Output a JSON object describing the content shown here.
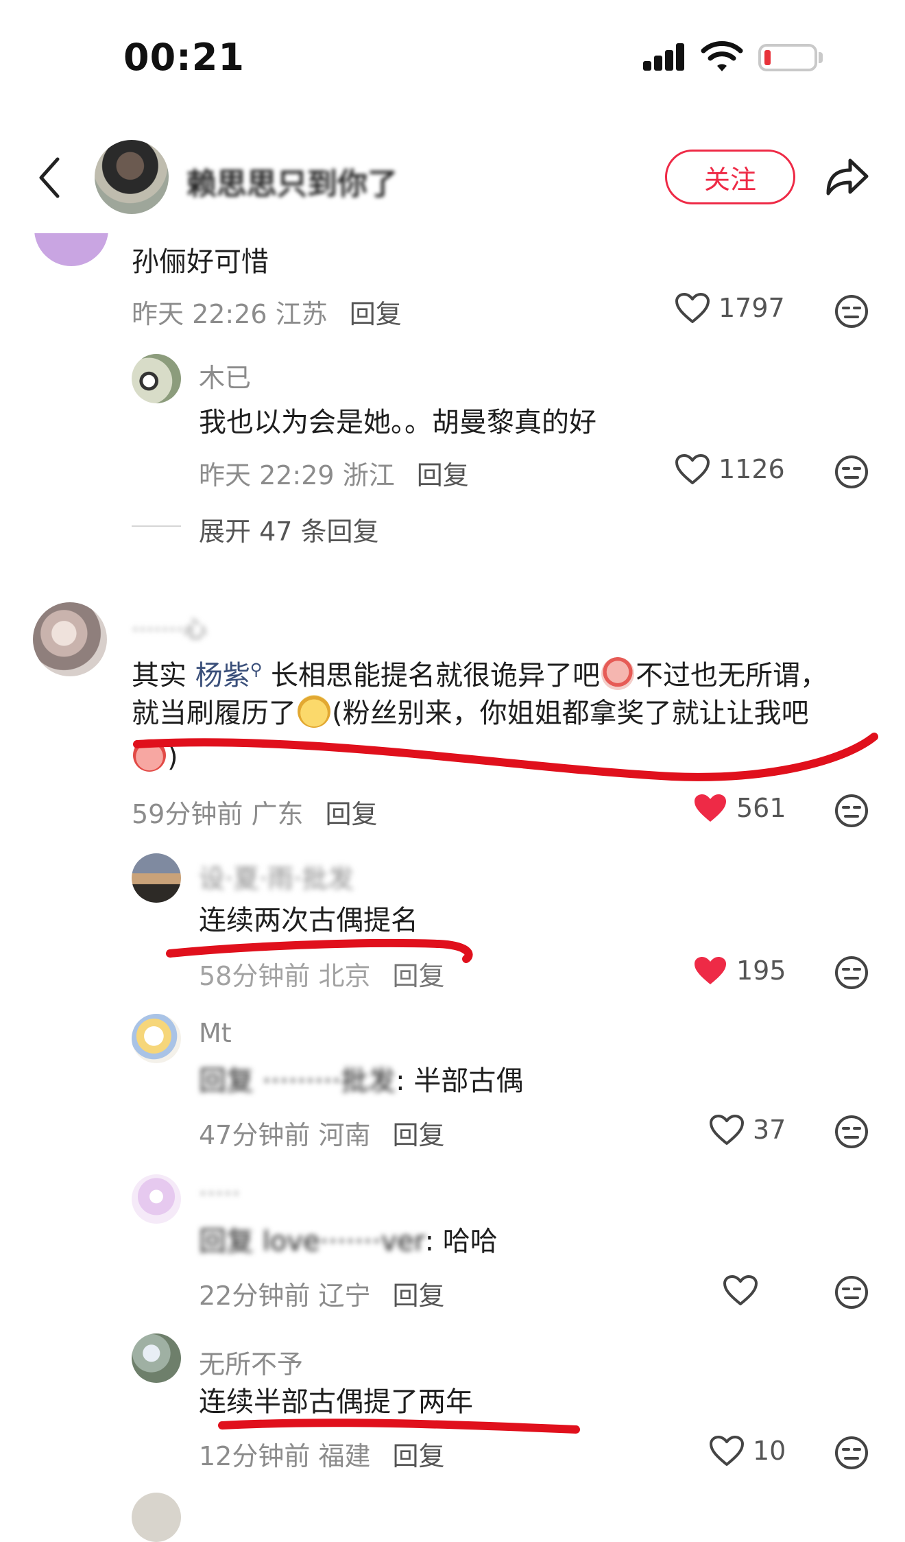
{
  "status_bar": {
    "time": "00:21"
  },
  "header": {
    "username": "赖思思只到你了",
    "follow_label": "关注"
  },
  "comments": [
    {
      "text": "孙俪好可惜",
      "time": "昨天 22:26",
      "location": "江苏",
      "reply_label": "回复",
      "likes": "1797",
      "liked": false,
      "replies": [
        {
          "username": "木已",
          "text": "我也以为会是她。。胡曼黎真的好",
          "time": "昨天 22:29",
          "location": "浙江",
          "reply_label": "回复",
          "likes": "1126",
          "liked": false
        }
      ],
      "expand_label": "展开 47 条回复"
    },
    {
      "username": "·······心",
      "text_pre": "其实 ",
      "mention": "杨紫",
      "text_line1": " 长相思能提名就很诡异了吧",
      "text_line1b": "不过也无所谓，",
      "text_line2a": "就当刷履历了",
      "text_line2b": "(粉丝别来，你姐姐都拿奖了就让让我吧",
      "text_line3": ")",
      "time": "59分钟前",
      "location": "广东",
      "reply_label": "回复",
      "likes": "561",
      "liked": true,
      "replies": [
        {
          "username": "设·夏·雨·批发",
          "text": "连续两次古偶提名",
          "time": "58分钟前",
          "location": "北京",
          "reply_label": "回复",
          "likes": "195",
          "liked": true
        },
        {
          "username": "Mt",
          "text_prefix": "回复 ·········批发",
          "text": ": 半部古偶",
          "time": "47分钟前",
          "location": "河南",
          "reply_label": "回复",
          "likes": "37",
          "liked": false
        },
        {
          "username": "·····",
          "text_prefix": "回复 love·······ver",
          "text": ": 哈哈",
          "time": "22分钟前",
          "location": "辽宁",
          "reply_label": "回复",
          "likes": "",
          "liked": false
        },
        {
          "username": "无所不予",
          "text": "连续半部古偶提了两年",
          "time": "12分钟前",
          "location": "福建",
          "reply_label": "回复",
          "likes": "10",
          "liked": false
        }
      ]
    }
  ],
  "colors": {
    "accent": "#ee2a46",
    "annotation_red": "#e0101c"
  }
}
